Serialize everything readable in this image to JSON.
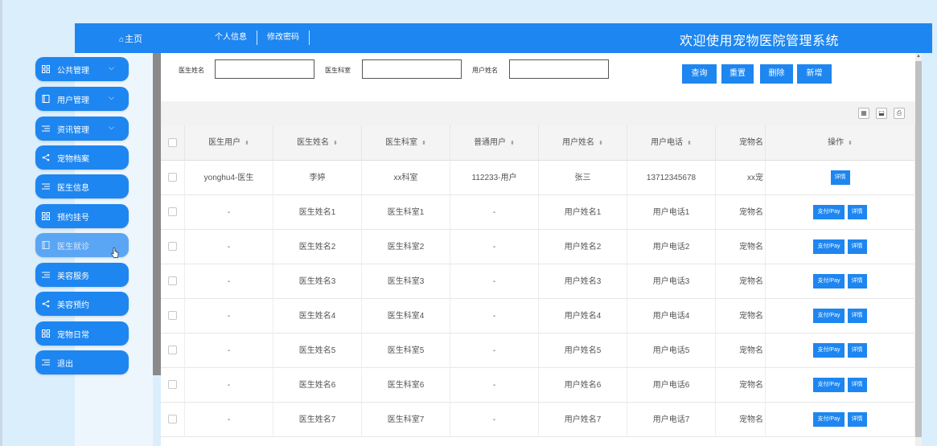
{
  "header": {
    "home_icon": "home-icon",
    "home_label": "主页",
    "nav": [
      "个人信息",
      "修改密码"
    ],
    "system_title": "欢迎使用宠物医院管理系统"
  },
  "sidebar": {
    "items": [
      {
        "label": "公共管理",
        "icon": "grid-icon",
        "has_chevron": true
      },
      {
        "label": "用户管理",
        "icon": "book-icon",
        "has_chevron": true
      },
      {
        "label": "资讯管理",
        "icon": "list-icon",
        "has_chevron": true
      },
      {
        "label": "宠物档案",
        "icon": "share-icon"
      },
      {
        "label": "医生信息",
        "icon": "list-icon"
      },
      {
        "label": "预约挂号",
        "icon": "grid-icon"
      },
      {
        "label": "医生就诊",
        "icon": "book-icon",
        "active": true
      },
      {
        "label": "美容服务",
        "icon": "list-icon"
      },
      {
        "label": "美容预约",
        "icon": "share-icon"
      },
      {
        "label": "宠物日常",
        "icon": "grid-icon"
      },
      {
        "label": "退出",
        "icon": "list-icon"
      }
    ]
  },
  "search": {
    "doctor_name_label": "医生姓名",
    "doctor_name_value": "",
    "department_label": "医生科室",
    "department_value": "",
    "user_name_label": "用户姓名",
    "user_name_value": "",
    "buttons": {
      "query": "查询",
      "reset": "重置",
      "delete": "删除",
      "add": "新增"
    }
  },
  "toolbar": {
    "icons": [
      "columns-icon",
      "export-icon",
      "print-icon"
    ]
  },
  "table": {
    "columns": [
      "医生用户",
      "医生姓名",
      "医生科室",
      "普通用户",
      "用户姓名",
      "用户电话",
      "宠物名",
      "操作"
    ],
    "rows": [
      {
        "cells": [
          "yonghu4-医生",
          "李婷",
          "xx科室",
          "112233-用户",
          "张三",
          "13712345678",
          "xx宠"
        ],
        "actions": [
          "详情"
        ]
      },
      {
        "cells": [
          "-",
          "医生姓名1",
          "医生科室1",
          "-",
          "用户姓名1",
          "用户电话1",
          "宠物名"
        ],
        "actions": [
          "支付/Pay",
          "详情"
        ]
      },
      {
        "cells": [
          "-",
          "医生姓名2",
          "医生科室2",
          "-",
          "用户姓名2",
          "用户电话2",
          "宠物名"
        ],
        "actions": [
          "支付/Pay",
          "详情"
        ]
      },
      {
        "cells": [
          "-",
          "医生姓名3",
          "医生科室3",
          "-",
          "用户姓名3",
          "用户电话3",
          "宠物名"
        ],
        "actions": [
          "支付/Pay",
          "详情"
        ]
      },
      {
        "cells": [
          "-",
          "医生姓名4",
          "医生科室4",
          "-",
          "用户姓名4",
          "用户电话4",
          "宠物名"
        ],
        "actions": [
          "支付/Pay",
          "详情"
        ]
      },
      {
        "cells": [
          "-",
          "医生姓名5",
          "医生科室5",
          "-",
          "用户姓名5",
          "用户电话5",
          "宠物名"
        ],
        "actions": [
          "支付/Pay",
          "详情"
        ]
      },
      {
        "cells": [
          "-",
          "医生姓名6",
          "医生科室6",
          "-",
          "用户姓名6",
          "用户电话6",
          "宠物名"
        ],
        "actions": [
          "支付/Pay",
          "详情"
        ]
      },
      {
        "cells": [
          "-",
          "医生姓名7",
          "医生科室7",
          "-",
          "用户姓名7",
          "用户电话7",
          "宠物名"
        ],
        "actions": [
          "支付/Pay",
          "详情"
        ]
      }
    ]
  },
  "colors": {
    "primary": "#1e86f0",
    "active_menu": "#5aa6f5",
    "page_bg": "#dbeefb"
  }
}
